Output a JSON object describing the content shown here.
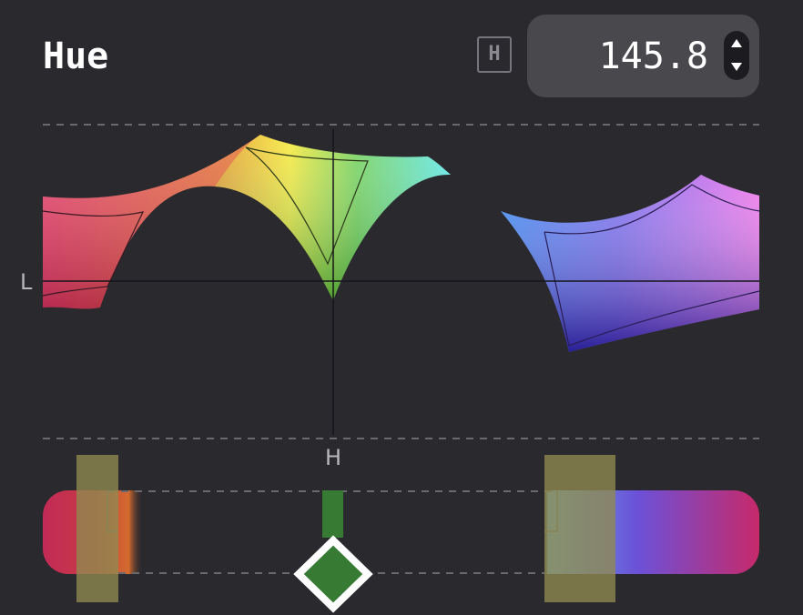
{
  "header": {
    "title": "Hue",
    "mode_badge": "H",
    "value": "145.8"
  },
  "graph": {
    "y_axis_label": "L",
    "x_axis_label": "H"
  },
  "icons": {
    "stepper_up": "triangle-up-icon",
    "stepper_down": "triangle-down-icon",
    "handle": "diamond-handle-icon"
  },
  "colors": {
    "background": "#2a292e",
    "value_box": "#49484d",
    "handle_fill": "#367a33",
    "highlight_band": "#8f8a4f"
  }
}
